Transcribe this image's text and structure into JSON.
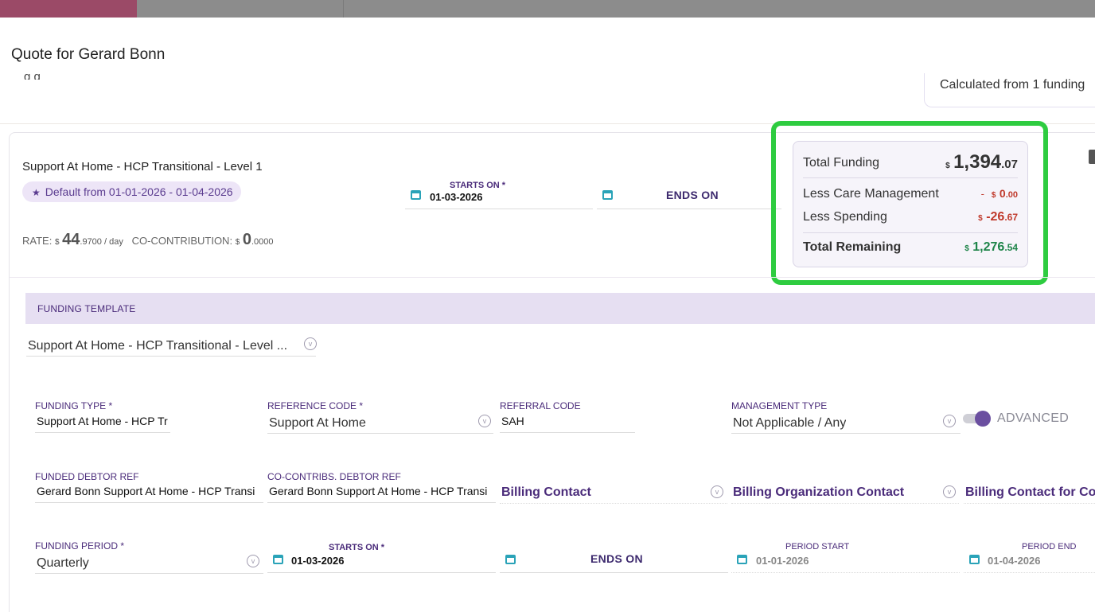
{
  "dialog": {
    "title": "Quote for Gerard Bonn",
    "cut_text": "       g                                              g  ",
    "calc_note": "Calculated from 1 funding"
  },
  "plan": {
    "title": "Support At Home - HCP Transitional - Level 1",
    "default_badge": "Default from 01-01-2026 - 01-04-2026",
    "starts_on_label": "STARTS ON *",
    "starts_on_value": "01-03-2026",
    "ends_on_label": "ENDS ON",
    "rate": {
      "label": "RATE:",
      "currency": "$",
      "whole": "44",
      "decimal": ".9700 / day"
    },
    "co_contribution": {
      "label": "CO-CONTRIBUTION:",
      "currency": "$",
      "whole": "0",
      "decimal": ".0000"
    }
  },
  "summary": {
    "total_funding_label": "Total Funding",
    "total_funding": {
      "currency": "$",
      "whole": "1,394",
      "decimal": ".07"
    },
    "care_mgmt_label": "Less Care Management",
    "care_mgmt": {
      "prefix": "-",
      "currency": "$",
      "whole": "0",
      "decimal": ".00"
    },
    "spending_label": "Less Spending",
    "spending": {
      "currency": "$",
      "whole": "-26",
      "decimal": ".67"
    },
    "remaining_label": "Total Remaining",
    "remaining": {
      "currency": "$",
      "whole": "1,276",
      "decimal": ".54"
    },
    "colors": {
      "negative": "#c0392b",
      "positive": "#1e8449",
      "highlight_border": "#2ecc40"
    }
  },
  "template": {
    "section_label": "FUNDING TEMPLATE",
    "selected": "Support At Home - HCP Transitional - Level ..."
  },
  "fields": {
    "funding_type": {
      "label": "FUNDING TYPE",
      "value": "Support At Home - HCP Tr"
    },
    "reference_code": {
      "label": "REFERENCE CODE",
      "value": "Support At Home"
    },
    "referral_code": {
      "label": "REFERRAL CODE",
      "value": "SAH"
    },
    "management_type": {
      "label": "MANAGEMENT TYPE",
      "value": "Not Applicable / Any"
    },
    "advanced_label": "ADVANCED",
    "funded_debtor_ref": {
      "label": "FUNDED DEBTOR REF",
      "value": "Gerard Bonn Support At Home - HCP Transi"
    },
    "co_contribs_debtor_ref": {
      "label": "CO-CONTRIBS. DEBTOR REF",
      "value": "Gerard Bonn Support At Home - HCP Transi"
    },
    "billing_contact": "Billing Contact",
    "billing_org_contact": "Billing Organization Contact",
    "billing_contact_co": "Billing Contact for Co-C",
    "funding_period": {
      "label": "FUNDING PERIOD",
      "value": "Quarterly"
    },
    "period_starts_on": {
      "label": "STARTS ON *",
      "value": "01-03-2026"
    },
    "period_ends_on": {
      "label": "ENDS ON"
    },
    "period_start": {
      "label": "PERIOD START",
      "value": "01-01-2026"
    },
    "period_end": {
      "label": "PERIOD END",
      "value": "01-04-2026"
    },
    "required_mark": "*"
  },
  "icons": {
    "star": "star-icon",
    "calendar": "calendar-icon",
    "chevron": "chevron-down-icon",
    "trash": "trash-icon"
  }
}
